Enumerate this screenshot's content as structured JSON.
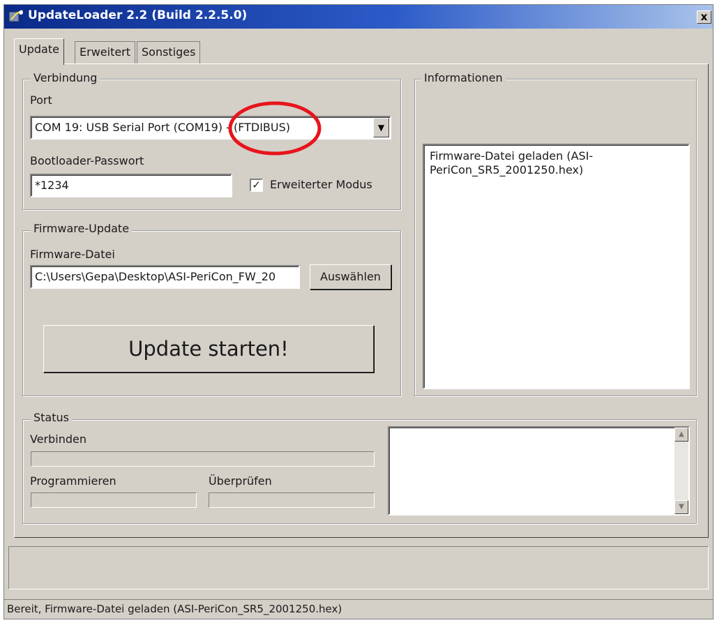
{
  "window": {
    "title": "UpdateLoader 2.2 (Build 2.2.5.0)",
    "close_label": "x"
  },
  "tabs": [
    {
      "label": "Update",
      "active": true
    },
    {
      "label": "Erweitert",
      "active": false
    },
    {
      "label": "Sonstiges",
      "active": false
    }
  ],
  "verbindung": {
    "legend": "Verbindung",
    "port_label": "Port",
    "port_value": "COM 19: USB Serial Port (COM19) - (FTDIBUS)",
    "password_label": "Bootloader-Passwort",
    "password_value": "*1234",
    "extended_mode_label": "Erweiterter Modus",
    "extended_mode_checked": true
  },
  "firmware": {
    "legend": "Firmware-Update",
    "file_label": "Firmware-Datei",
    "file_value": "C:\\Users\\Gepa\\Desktop\\ASI-PeriCon_FW_20",
    "choose_button": "Auswählen",
    "start_button": "Update starten!"
  },
  "informationen": {
    "legend": "Informationen",
    "log_line1": "Firmware-Datei geladen (ASI-",
    "log_line2": "PeriCon_SR5_2001250.hex)"
  },
  "status": {
    "legend": "Status",
    "connect_label": "Verbinden",
    "program_label": "Programmieren",
    "verify_label": "Überprüfen",
    "connect_progress": 0,
    "program_progress": 0,
    "verify_progress": 0
  },
  "statusbar": {
    "text": "Bereit, Firmware-Datei geladen (ASI-PeriCon_SR5_2001250.hex)"
  },
  "annotation": {
    "color": "#e8141c"
  },
  "colors": {
    "titlebar_start": "#0a2a8a",
    "titlebar_end": "#a9c3ea",
    "window_bg": "#d4d0c8"
  }
}
